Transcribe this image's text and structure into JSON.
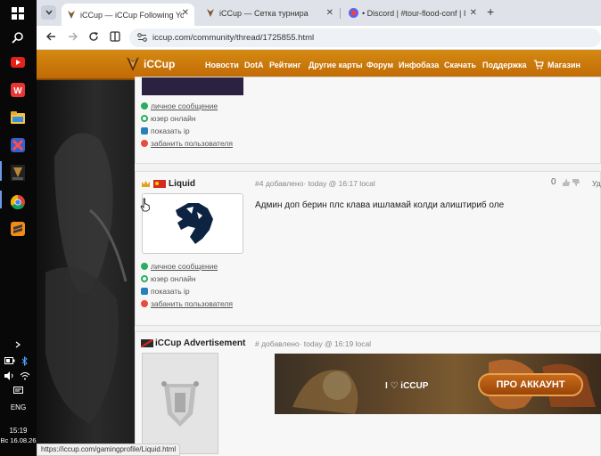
{
  "taskbar": {
    "time": "15:19",
    "date": "Вс 16.08.26",
    "lang": "ENG"
  },
  "tabs": [
    {
      "label": "iCCup — iCCup Following Your",
      "active": true
    },
    {
      "label": "iCCup — Сетка турнира",
      "active": false
    },
    {
      "label": "• Discord | #tour-flood-conf | I",
      "active": false
    }
  ],
  "url": "iccup.com/community/thread/1725855.html",
  "site": {
    "logo": "iCCup",
    "nav": [
      "Новости",
      "DotA",
      "Рейтинг",
      "Другие карты",
      "Форум",
      "Инфобаза",
      "Скачать",
      "Поддержка",
      "Магазин"
    ]
  },
  "user_links": [
    "личное сообщение",
    "юзер онлайн",
    "показать ip",
    "забанить пользователя"
  ],
  "post4": {
    "username": "Liquid",
    "meta": "#4 добавлено· today @ 16:17 local",
    "score": "0",
    "message": "Админ доп берин плс клава ишламай колди алиштириб оле",
    "extra": "Уд"
  },
  "ad": {
    "username": "iCCup Advertisement",
    "meta": "# добавлено· today @ 16:19 local",
    "banner_label": "ПРО АККАУНТ",
    "banner_brand": "I ♡ iCCUP"
  },
  "statusbar": "https://iccup.com/gamingprofile/Liquid.html"
}
